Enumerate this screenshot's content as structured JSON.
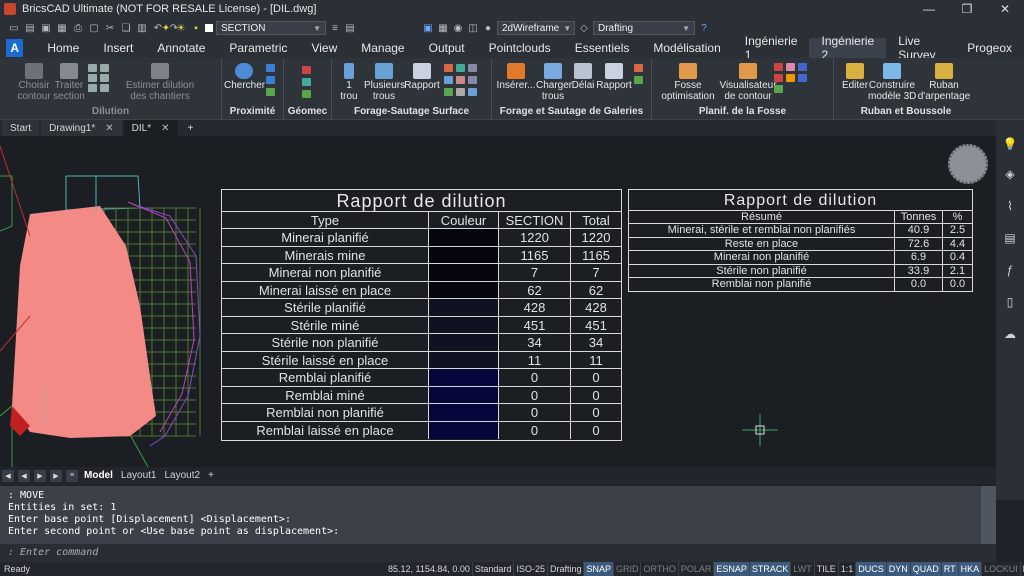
{
  "window": {
    "title": "BricsCAD Ultimate (NOT FOR RESALE License) - [DIL.dwg]",
    "controls": [
      "—",
      "❐",
      "✕"
    ]
  },
  "qat": {
    "layer_combo": "SECTION",
    "visual_style": "2dWireframe",
    "workspace": "Drafting"
  },
  "menu": {
    "tabs": [
      "Home",
      "Insert",
      "Annotate",
      "Parametric",
      "View",
      "Manage",
      "Output",
      "Pointclouds",
      "Essentiels",
      "Modélisation",
      "Ingénierie 1",
      "Ingénierie 2",
      "Live Survey",
      "Progeox"
    ],
    "active_index": 11
  },
  "ribbon": {
    "groups": [
      {
        "label": "Dilution",
        "buttons": [
          "Choisir\ncontour",
          "Traiter\nsection",
          "Estimer dilution\ndes chantiers"
        ]
      },
      {
        "label": "Proximité",
        "buttons": [
          "Chercher"
        ]
      },
      {
        "label": "Géomec",
        "buttons": []
      },
      {
        "label": "Forage-Sautage Surface",
        "buttons": [
          "1\ntrou",
          "Plusieurs\ntrous",
          "Rapport"
        ]
      },
      {
        "label": "Forage et Sautage de Galeries",
        "buttons": [
          "Insérer...",
          "Charger\ntrous",
          "Délai",
          "Rapport"
        ]
      },
      {
        "label": "Planif. de la Fosse",
        "buttons": [
          "Fosse\noptimisation",
          "Visualisateur\nde contour"
        ]
      },
      {
        "label": "Ruban et Boussole",
        "buttons": [
          "Editer",
          "Construire\nmodèle 3D",
          "Ruban\nd'arpentage"
        ]
      }
    ]
  },
  "doc_tabs": [
    {
      "label": "Start"
    },
    {
      "label": "Drawing1*"
    },
    {
      "label": "DIL*"
    }
  ],
  "table1": {
    "title": "Rapport  de  dilution",
    "headers": [
      "Type",
      "Couleur",
      "SECTION",
      "Total"
    ],
    "rows": [
      {
        "type": "Minerai planifié",
        "section": "1220",
        "total": "1220",
        "color": "#07060f"
      },
      {
        "type": "Minerais mine",
        "section": "1165",
        "total": "1165",
        "color": "#07060f"
      },
      {
        "type": "Minerai non planifié",
        "section": "7",
        "total": "7",
        "color": "#07060f"
      },
      {
        "type": "Minerai laissé en place",
        "section": "62",
        "total": "62",
        "color": "#07060f"
      },
      {
        "type": "Stérile planifié",
        "section": "428",
        "total": "428",
        "color": "#0f1220"
      },
      {
        "type": "Stérile miné",
        "section": "451",
        "total": "451",
        "color": "#0f1220"
      },
      {
        "type": "Stérile non planifié",
        "section": "34",
        "total": "34",
        "color": "#0f1220"
      },
      {
        "type": "Stérile laissé en place",
        "section": "11",
        "total": "11",
        "color": "#0f1220"
      },
      {
        "type": "Remblai planifié",
        "section": "0",
        "total": "0",
        "color": "#06063a"
      },
      {
        "type": "Remblai miné",
        "section": "0",
        "total": "0",
        "color": "#06063a"
      },
      {
        "type": "Remblai non planifié",
        "section": "0",
        "total": "0",
        "color": "#06063a"
      },
      {
        "type": "Remblai laissé en place",
        "section": "0",
        "total": "0",
        "color": "#06063a"
      }
    ]
  },
  "table2": {
    "title": "Rapport  de  dilution",
    "headers": [
      "Résumé",
      "Tonnes",
      "%"
    ],
    "rows": [
      {
        "label": "Minerai, stérile et remblai non planifiés",
        "tonnes": "40.9",
        "pct": "2.5"
      },
      {
        "label": "Reste en place",
        "tonnes": "72.6",
        "pct": "4.4"
      },
      {
        "label": "Minerai non planifié",
        "tonnes": "6.9",
        "pct": "0.4"
      },
      {
        "label": "Stérile non planifié",
        "tonnes": "33.9",
        "pct": "2.1"
      },
      {
        "label": "Remblai non planifié",
        "tonnes": "0.0",
        "pct": "0.0"
      }
    ]
  },
  "layout_tabs": [
    "Model",
    "Layout1",
    "Layout2",
    "+"
  ],
  "command": {
    "history": [
      ": MOVE",
      "Entities in set: 1",
      "Enter base point [Displacement] <Displacement>:",
      "Enter second point or <Use base point as displacement>:"
    ],
    "prompt": ": Enter command"
  },
  "status": {
    "ready": "Ready",
    "coords": "85.12, 1154.84, 0.00",
    "items": [
      {
        "t": "Standard",
        "s": "n"
      },
      {
        "t": "ISO-25",
        "s": "n"
      },
      {
        "t": "Drafting",
        "s": "n"
      },
      {
        "t": "SNAP",
        "s": "on"
      },
      {
        "t": "GRID",
        "s": "off"
      },
      {
        "t": "ORTHO",
        "s": "off"
      },
      {
        "t": "POLAR",
        "s": "off"
      },
      {
        "t": "ESNAP",
        "s": "on"
      },
      {
        "t": "STRACK",
        "s": "on"
      },
      {
        "t": "LWT",
        "s": "off"
      },
      {
        "t": "TILE",
        "s": "n"
      },
      {
        "t": "1:1",
        "s": "n"
      },
      {
        "t": "DUCS",
        "s": "on"
      },
      {
        "t": "DYN",
        "s": "on"
      },
      {
        "t": "QUAD",
        "s": "on"
      },
      {
        "t": "RT",
        "s": "on"
      },
      {
        "t": "HKA",
        "s": "on"
      },
      {
        "t": "LOCKUI",
        "s": "off"
      },
      {
        "t": "None",
        "s": "n"
      }
    ]
  },
  "colors": {
    "accent": "#1b6ad0",
    "ore_fill": "#f48a86",
    "grid_green": "#4f7a2e",
    "purple": "#8a48c8"
  }
}
